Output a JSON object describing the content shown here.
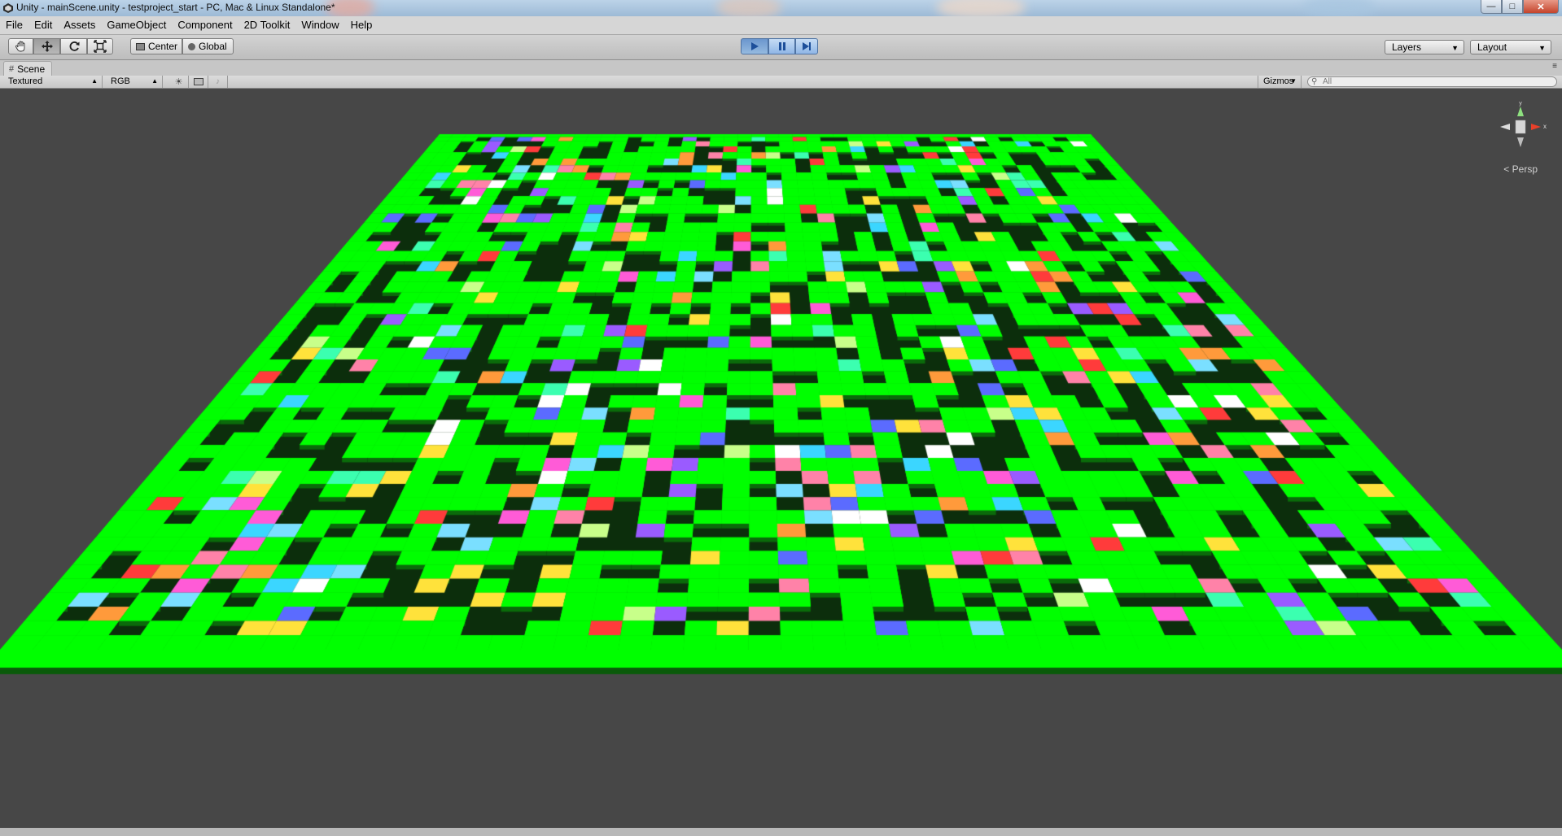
{
  "window": {
    "title": "Unity - mainScene.unity - testproject_start - PC, Mac & Linux Standalone*",
    "controls": [
      "minimize",
      "maximize",
      "close"
    ]
  },
  "menu": [
    "File",
    "Edit",
    "Assets",
    "GameObject",
    "Component",
    "2D Toolkit",
    "Window",
    "Help"
  ],
  "toolbar": {
    "tools": [
      {
        "name": "hand-tool",
        "icon": "hand-icon",
        "selected": false
      },
      {
        "name": "move-tool",
        "icon": "move-arrows-icon",
        "selected": true
      },
      {
        "name": "rotate-tool",
        "icon": "rotate-icon",
        "selected": false
      },
      {
        "name": "scale-tool",
        "icon": "scale-icon",
        "selected": false
      }
    ],
    "pivot_mode": "Center",
    "pivot_rotation": "Global",
    "playback": [
      "play",
      "pause",
      "step"
    ],
    "layers_label": "Layers",
    "layout_label": "Layout"
  },
  "scene_tab": {
    "label": "Scene"
  },
  "scene_bar": {
    "render_mode": "Textured",
    "color_mode": "RGB",
    "gizmos_label": "Gizmos",
    "search_placeholder": "All"
  },
  "viewport": {
    "projection_label": "Persp",
    "background_color": "#474747",
    "wall_color": "#00ff00",
    "floor_color": "#0c2e0c"
  },
  "colors": {
    "accent_blue": "#6b96cd",
    "menu_bg": "#d6d6d6"
  }
}
